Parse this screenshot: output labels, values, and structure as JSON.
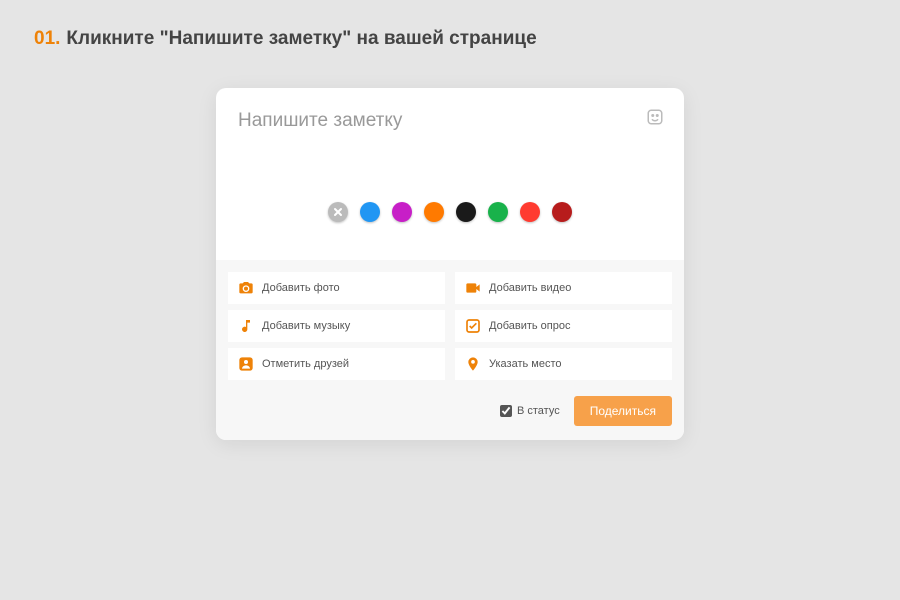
{
  "heading": {
    "num": "01.",
    "text": "Кликните \"Напишите заметку\" на вашей странице"
  },
  "note": {
    "placeholder": "Напишите заметку"
  },
  "colors": {
    "items": [
      {
        "name": "close",
        "value": "#bbbbbb"
      },
      {
        "name": "blue",
        "value": "#2196f3"
      },
      {
        "name": "magenta",
        "value": "#c71fc7"
      },
      {
        "name": "orange",
        "value": "#ff7a00"
      },
      {
        "name": "black",
        "value": "#1a1a1a"
      },
      {
        "name": "green",
        "value": "#19b24b"
      },
      {
        "name": "red-orange",
        "value": "#ff3b30"
      },
      {
        "name": "dark-red",
        "value": "#b71c1c"
      }
    ]
  },
  "attachments": {
    "photo": "Добавить фото",
    "video": "Добавить видео",
    "music": "Добавить музыку",
    "poll": "Добавить опрос",
    "friends": "Отметить друзей",
    "place": "Указать место"
  },
  "footer": {
    "status_label": "В статус",
    "status_checked": true,
    "share_label": "Поделиться"
  }
}
